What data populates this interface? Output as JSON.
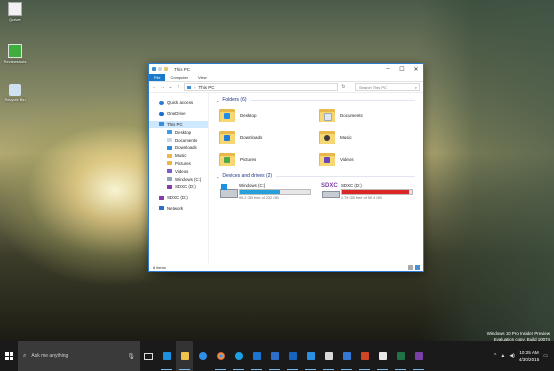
{
  "desktop": {
    "icons": [
      {
        "name": "quiver",
        "label": "Quiver",
        "color": "#f2f2f2"
      },
      {
        "name": "reviewshots",
        "label": "Reviewshots",
        "color": "#3fae3f"
      },
      {
        "name": "recycle-bin",
        "label": "Recycle Bin",
        "color": "#cfe0ee"
      }
    ],
    "watermark": {
      "line1": "Windows 10 Pro Insider Preview",
      "line2": "Evaluation copy. Build 10074"
    }
  },
  "explorer": {
    "title": "This PC",
    "ribbon_tabs": [
      "File",
      "Computer",
      "View"
    ],
    "address": "This PC",
    "search_placeholder": "Search This PC",
    "nav": [
      {
        "label": "Quick access",
        "icon": "star-icon",
        "color": "#2a7ad5",
        "level": 0
      },
      {
        "label": "OneDrive",
        "icon": "cloud-icon",
        "color": "#1a6fd1",
        "level": 0
      },
      {
        "label": "This PC",
        "icon": "computer-icon",
        "color": "#3b8dd6",
        "level": 0,
        "selected": true
      },
      {
        "label": "Desktop",
        "icon": "desktop-folder-icon",
        "color": "#3a9ee0",
        "level": 1
      },
      {
        "label": "Documents",
        "icon": "documents-folder-icon",
        "color": "#c9d7e6",
        "level": 1
      },
      {
        "label": "Downloads",
        "icon": "downloads-folder-icon",
        "color": "#2f8be0",
        "level": 1
      },
      {
        "label": "Music",
        "icon": "music-folder-icon",
        "color": "#e9b943",
        "level": 1
      },
      {
        "label": "Pictures",
        "icon": "pictures-folder-icon",
        "color": "#e9b943",
        "level": 1
      },
      {
        "label": "Videos",
        "icon": "videos-folder-icon",
        "color": "#7a5ac8",
        "level": 1
      },
      {
        "label": "Windows (C:)",
        "icon": "drive-icon",
        "color": "#8fa3b8",
        "level": 1
      },
      {
        "label": "SDXC (D:)",
        "icon": "sd-card-icon",
        "color": "#8a3aa8",
        "level": 1
      },
      {
        "label": "SDXC (D:)",
        "icon": "sd-card-icon",
        "color": "#8a3aa8",
        "level": 0
      },
      {
        "label": "Network",
        "icon": "network-icon",
        "color": "#2f6cc6",
        "level": 0
      }
    ],
    "folders_header": "Folders (6)",
    "folders": [
      {
        "label": "Desktop",
        "badge": "#1e8fe3"
      },
      {
        "label": "Documents",
        "badge": "#dfe8f2"
      },
      {
        "label": "Downloads",
        "badge": "#1f7fd6"
      },
      {
        "label": "Music",
        "badge": "#3a3a3a"
      },
      {
        "label": "Pictures",
        "badge": "#4ca84a"
      },
      {
        "label": "Videos",
        "badge": "#6a47b8"
      }
    ],
    "drives_header": "Devices and drives (2)",
    "drives": [
      {
        "label": "Windows (C:)",
        "free": "99.2 GB free of 232 GB",
        "fill_percent": 57,
        "fill_color": "#26a0da"
      },
      {
        "label": "SDXC (D:)",
        "free": "2.79 GB free of 59.4 GB",
        "fill_percent": 95,
        "fill_color": "#da2626",
        "logo": "SDXC"
      }
    ],
    "status": "8 items"
  },
  "taskbar": {
    "search_placeholder": "Ask me anything",
    "apps": [
      {
        "name": "store",
        "color": "#1c8fe0",
        "running": true
      },
      {
        "name": "file-explorer",
        "color": "#f0c44c",
        "running": true,
        "active": true
      },
      {
        "name": "edge",
        "color": "#2f8ee5",
        "running": false
      },
      {
        "name": "chrome",
        "color": "#e8c33a",
        "running": true
      },
      {
        "name": "skype",
        "color": "#1aa1e8",
        "running": true
      },
      {
        "name": "mail",
        "color": "#1c74cf",
        "running": true
      },
      {
        "name": "onedrive",
        "color": "#2c6fca",
        "running": true
      },
      {
        "name": "outlook",
        "color": "#1565c0",
        "running": true
      },
      {
        "name": "photos",
        "color": "#2a90e2",
        "running": true
      },
      {
        "name": "paint",
        "color": "#d9d9d9",
        "running": true
      },
      {
        "name": "movies",
        "color": "#3278d4",
        "running": true
      },
      {
        "name": "powerpoint",
        "color": "#d04525",
        "running": true
      },
      {
        "name": "snipping",
        "color": "#e8e8e8",
        "running": true
      },
      {
        "name": "excel",
        "color": "#217346",
        "running": true
      },
      {
        "name": "onenote",
        "color": "#7b3fa8",
        "running": true
      }
    ],
    "time": "10:25 AM",
    "date": "4/30/2015"
  }
}
